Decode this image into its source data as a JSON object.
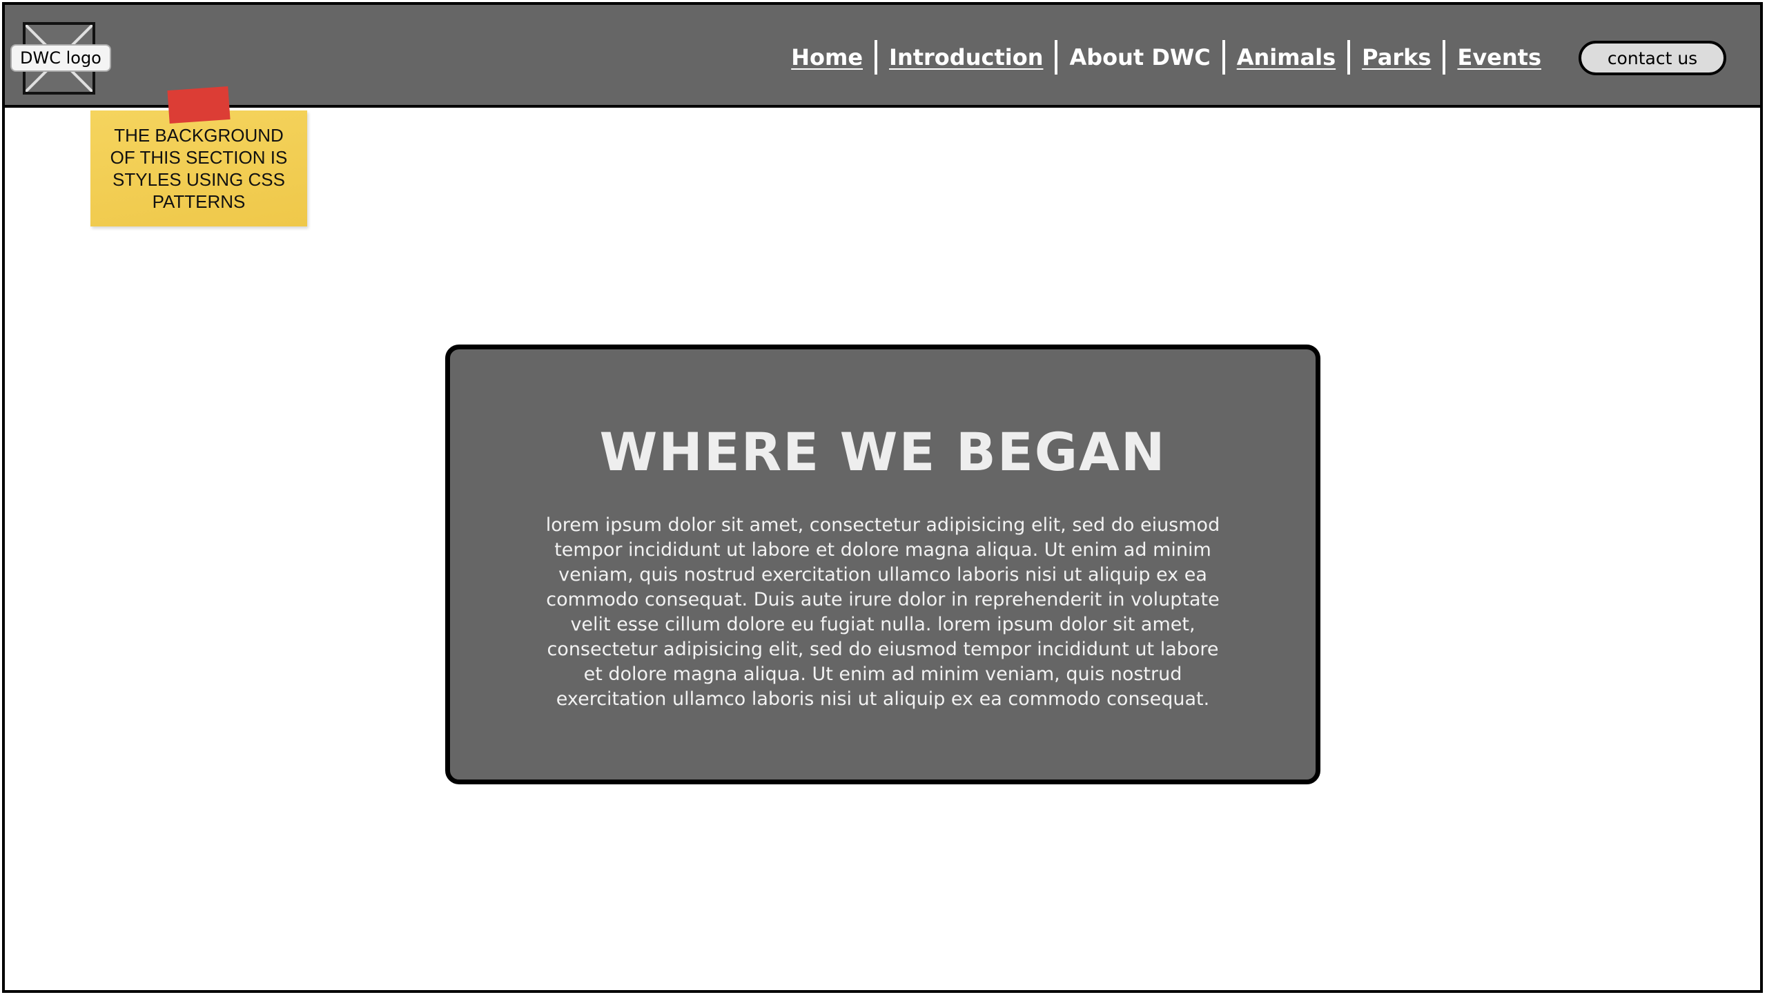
{
  "header": {
    "logo_label": "DWC logo",
    "nav": [
      {
        "label": "Home",
        "link": true
      },
      {
        "label": "Introduction",
        "link": true
      },
      {
        "label": "About DWC",
        "link": false
      },
      {
        "label": "Animals",
        "link": true
      },
      {
        "label": "Parks",
        "link": true
      },
      {
        "label": "Events",
        "link": true
      }
    ],
    "contact_label": "contact us"
  },
  "note": {
    "text": "THE BACKGROUND OF THIS SECTION IS STYLES USING CSS PATTERNS"
  },
  "main": {
    "title": "WHERE WE BEGAN",
    "body": "lorem ipsum dolor sit amet, consectetur adipisicing elit, sed do eiusmod tempor incididunt ut labore et dolore magna aliqua. Ut enim ad minim veniam, quis nostrud exercitation ullamco laboris nisi ut aliquip ex ea commodo consequat. Duis aute irure dolor in reprehenderit in voluptate velit esse cillum dolore eu fugiat nulla. lorem ipsum dolor sit amet, consectetur adipisicing elit, sed do eiusmod tempor incididunt ut labore et dolore magna aliqua. Ut enim ad minim veniam, quis nostrud exercitation ullamco laboris nisi ut aliquip ex ea commodo consequat."
  },
  "colors": {
    "header_bg": "#666666",
    "card_bg": "#666666",
    "note_bg": "#f2cb4f",
    "tape": "#dc3d35"
  }
}
